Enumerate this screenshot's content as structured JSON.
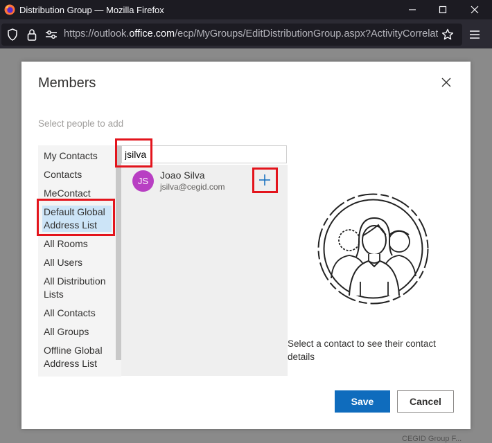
{
  "window": {
    "title": "Distribution Group — Mozilla Firefox"
  },
  "browser": {
    "url_prefix": "https://outlook.",
    "url_domain": "office.com",
    "url_path": "/ecp/MyGroups/EditDistributionGroup.aspx?ActivityCorrelation"
  },
  "background": {
    "footer_text": "CEGID Group F..."
  },
  "dialog": {
    "title": "Members",
    "hint": "Select people to add",
    "sources": [
      {
        "label": "My Contacts"
      },
      {
        "label": "Contacts"
      },
      {
        "label": "MeContact"
      },
      {
        "label": "Default Global Address List",
        "selected": true
      },
      {
        "label": "All Rooms"
      },
      {
        "label": "All Users"
      },
      {
        "label": "All Distribution Lists"
      },
      {
        "label": "All Contacts"
      },
      {
        "label": "All Groups"
      },
      {
        "label": "Offline Global Address List"
      }
    ],
    "search": {
      "value": "jsilva"
    },
    "results": [
      {
        "initials": "JS",
        "name": "Joao Silva",
        "email": "jsilva@cegid.com",
        "avatar_color": "#b83fc3"
      }
    ],
    "detail_message": "Select a contact to see their contact details",
    "save_label": "Save",
    "cancel_label": "Cancel"
  },
  "colors": {
    "accent": "#0f6cbd",
    "selected_bg": "#cce4f7",
    "annotation": "#e3141c"
  }
}
